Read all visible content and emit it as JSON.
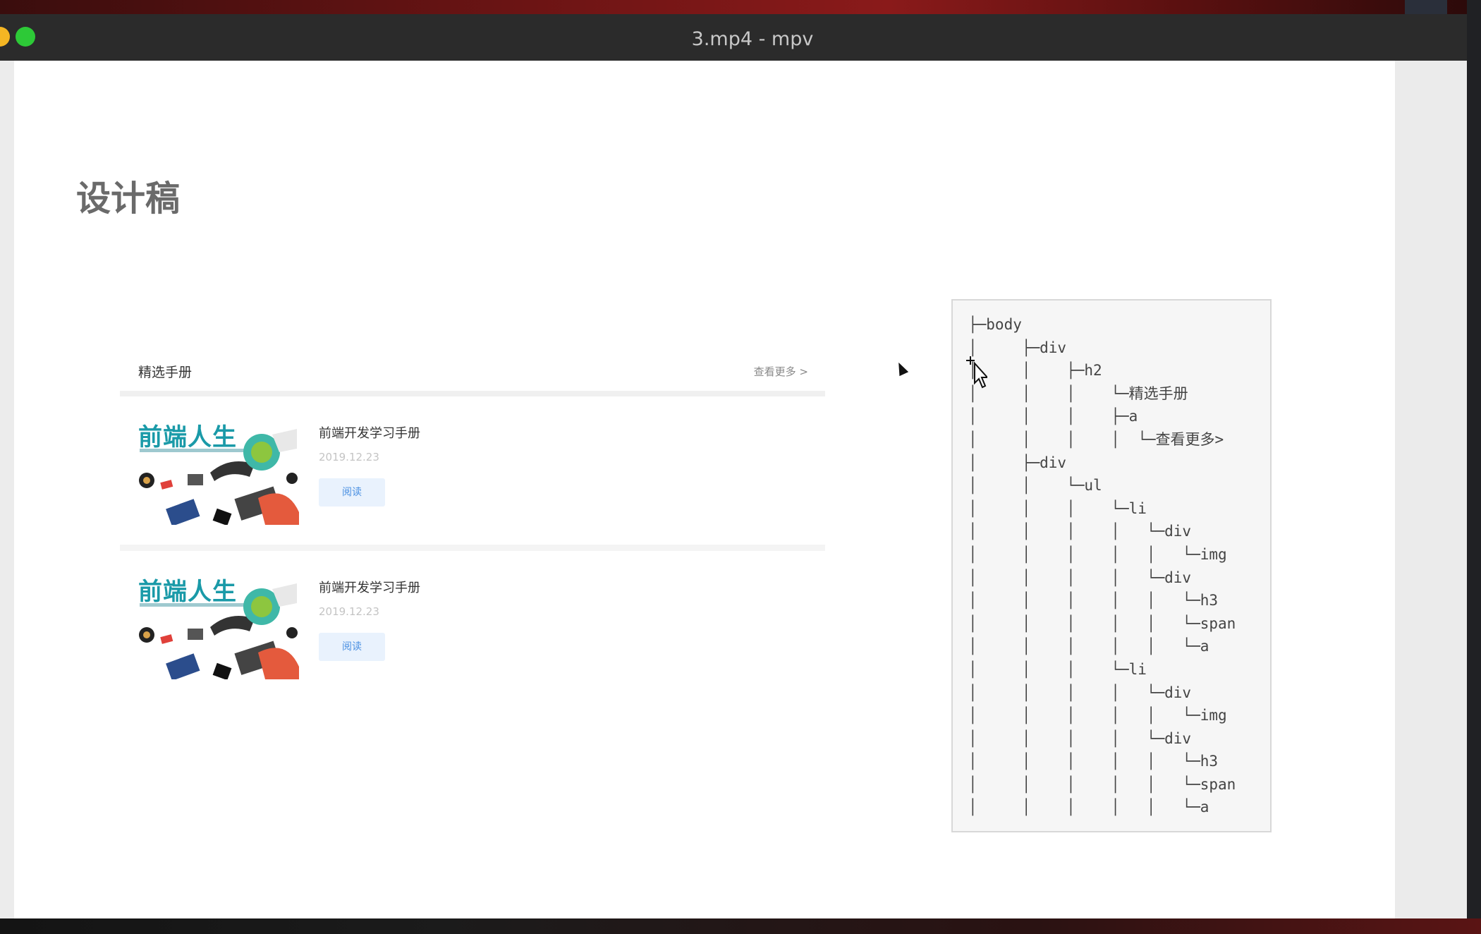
{
  "window": {
    "title": "3.mp4 - mpv"
  },
  "slide": {
    "title": "设计稿"
  },
  "card": {
    "header_title": "精选手册",
    "header_more": "查看更多 >",
    "items": [
      {
        "thumb_title": "前端人生",
        "title": "前端开发学习手册",
        "date": "2019.12.23",
        "button": "阅读"
      },
      {
        "thumb_title": "前端人生",
        "title": "前端开发学习手册",
        "date": "2019.12.23",
        "button": "阅读"
      }
    ]
  },
  "tree": {
    "text": "├─body\n│     ├─div\n│     │    ├─h2\n│     │    │    └─精选手册\n│     │    │    ├─a\n│     │    │    │  └─查看更多>\n│     ├─div\n│     │    └─ul\n│     │    │    └─li\n│     │    │    │   └─div\n│     │    │    │   │   └─img\n│     │    │    │   └─div\n│     │    │    │   │   └─h3\n│     │    │    │   │   └─span\n│     │    │    │   │   └─a\n│     │    │    └─li\n│     │    │    │   └─div\n│     │    │    │   │   └─img\n│     │    │    │   └─div\n│     │    │    │   │   └─h3\n│     │    │    │   │   └─span\n│     │    │    │   │   └─a"
  },
  "colors": {
    "accent_teal": "#1a9aa8",
    "button_blue": "#4a90e2"
  }
}
